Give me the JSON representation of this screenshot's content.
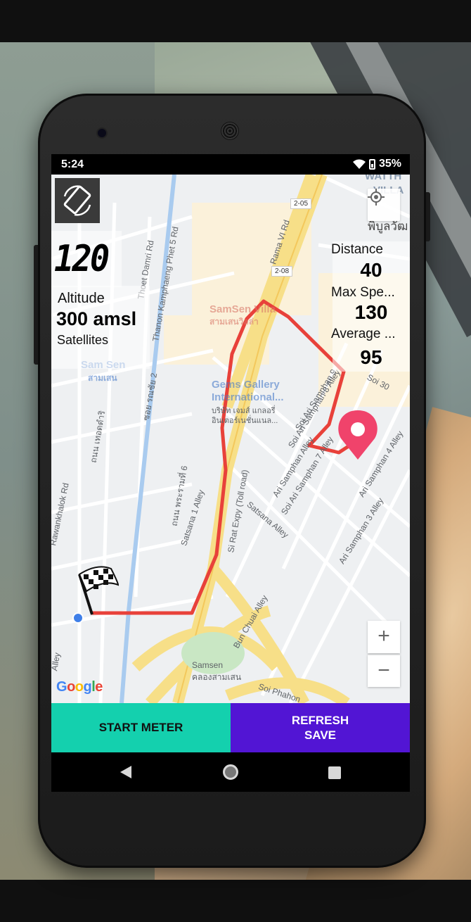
{
  "status_bar": {
    "time": "5:24",
    "battery": "35%"
  },
  "map": {
    "road_labels": {
      "thoet_damri": "Thoet Damri Rd",
      "phet5": "Thanon Kamphaeng Phet 5 Rd",
      "rama6": "Rama VI Rd",
      "shield1": "2-05",
      "shield2": "2-08",
      "samsen_villa": "SamSen Villa",
      "samsen_villa_th": "สามเสนวิลล่า",
      "samsen_station": "Sam Sen",
      "samsen_station_th": "สามเสน",
      "gems_gallery": "Gems Gallery",
      "gems_gallery2": "International...",
      "gems_th": "บริษัท เจมส์ แกลอรี่",
      "gems_th2": "อินเตอร์เนชั่นแนล...",
      "soi_ari_8": "Soi Ari Samphan 8 Alley",
      "soi_ari_7": "Soi Ari Samphan 7 Alley",
      "ari_samphan": "Ari Samphan Alley",
      "ari_4": "Ari Samphan 4 Alley",
      "ari_3": "Ari Samphan 3 Alley",
      "soi_ari_9": "Soi Ari Samphan 9",
      "soi30": "Soi 30",
      "satsana": "Satsana Alley",
      "satsana1": "Satsana 1 Alley",
      "si_rat": "Si Rat Expy (Toll road)",
      "bun_chuai": "Bun Chuai Alley",
      "samsen": "Samsen",
      "samsen_th": "คลองสามเสน",
      "soi_phahon": "Soi Phahon",
      "ratchawithi": "Rawankhalok Rd",
      "soi_rongmuang": "ซอย รณชัย 2",
      "thanon_rama6_th": "ถนน พระรามที่ 6",
      "thanon_th": "ถนน เทอดดำริ",
      "watthana": "WATTH",
      "villa": "VILLA",
      "phibun": "พิบูลวัฒ",
      "alley": "Alley"
    },
    "route_color": "#e8413a"
  },
  "speed": {
    "value": "120"
  },
  "altitude": {
    "label": "Altitude",
    "value": "300 amsl"
  },
  "satellites": {
    "label": "Satellites"
  },
  "stats": {
    "distance_label": "Distance",
    "distance_value": "40",
    "max_speed_label": "Max Spe...",
    "max_speed_value": "130",
    "average_label": "Average ...",
    "average_value": "95"
  },
  "zoom": {
    "in": "+",
    "out": "−"
  },
  "google_logo": "Google",
  "buttons": {
    "start_meter": "START METER",
    "refresh": "REFRESH",
    "save": "SAVE"
  },
  "colors": {
    "start_button": "#14d0ae",
    "refresh_button": "#5215d4",
    "marker": "#f0436b"
  }
}
